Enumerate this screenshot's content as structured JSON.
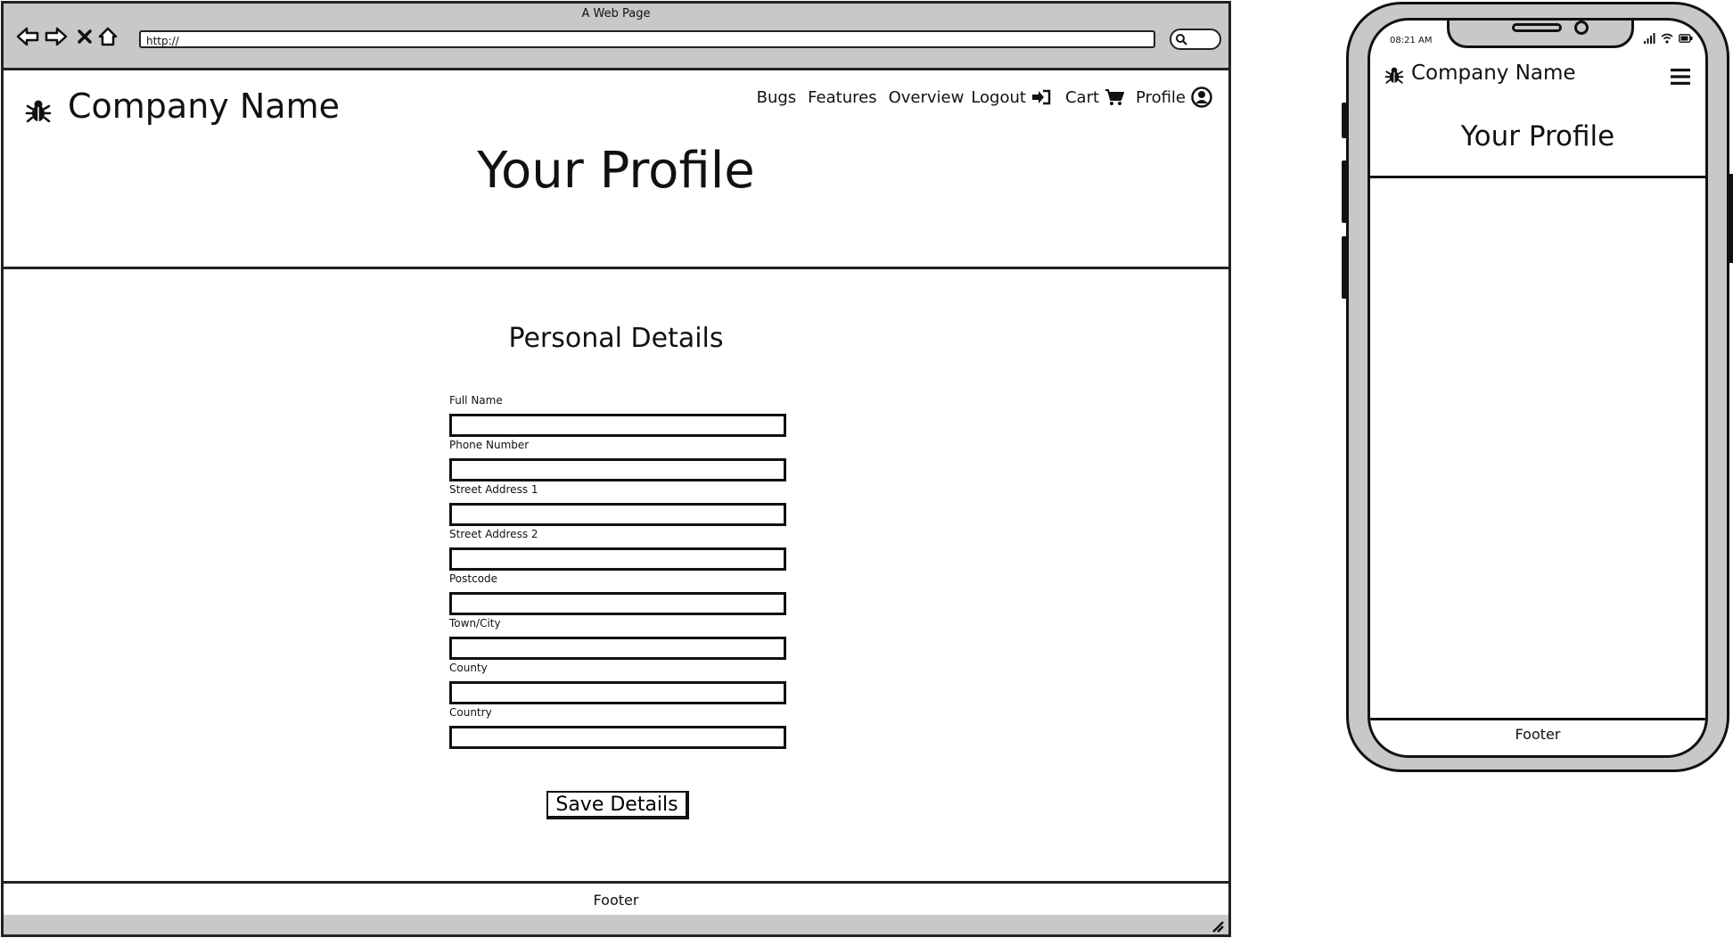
{
  "browser": {
    "window_title": "A Web Page",
    "url": "http://"
  },
  "header": {
    "brand": "Company Name",
    "nav": {
      "bugs": "Bugs",
      "features": "Features",
      "overview": "Overview",
      "logout": "Logout",
      "cart": "Cart",
      "profile": "Profile"
    },
    "page_title": "Your Profile"
  },
  "main": {
    "section_heading": "Personal Details",
    "fields": [
      {
        "label": "Full Name",
        "value": ""
      },
      {
        "label": "Phone Number",
        "value": ""
      },
      {
        "label": "Street Address 1",
        "value": ""
      },
      {
        "label": "Street Address 2",
        "value": ""
      },
      {
        "label": "Postcode",
        "value": ""
      },
      {
        "label": "Town/City",
        "value": ""
      },
      {
        "label": "County",
        "value": ""
      },
      {
        "label": "Country",
        "value": ""
      }
    ],
    "save_label": "Save Details"
  },
  "footer": {
    "text": "Footer"
  },
  "mobile": {
    "time": "08:21 AM",
    "brand": "Company Name",
    "page_title": "Your Profile",
    "footer": "Footer"
  },
  "icons": {
    "logo": "bug-icon",
    "logout": "sign-in-icon",
    "cart": "shopping-cart-icon",
    "profile": "user-circle-icon",
    "mobile_menu": "hamburger-menu-icon"
  }
}
